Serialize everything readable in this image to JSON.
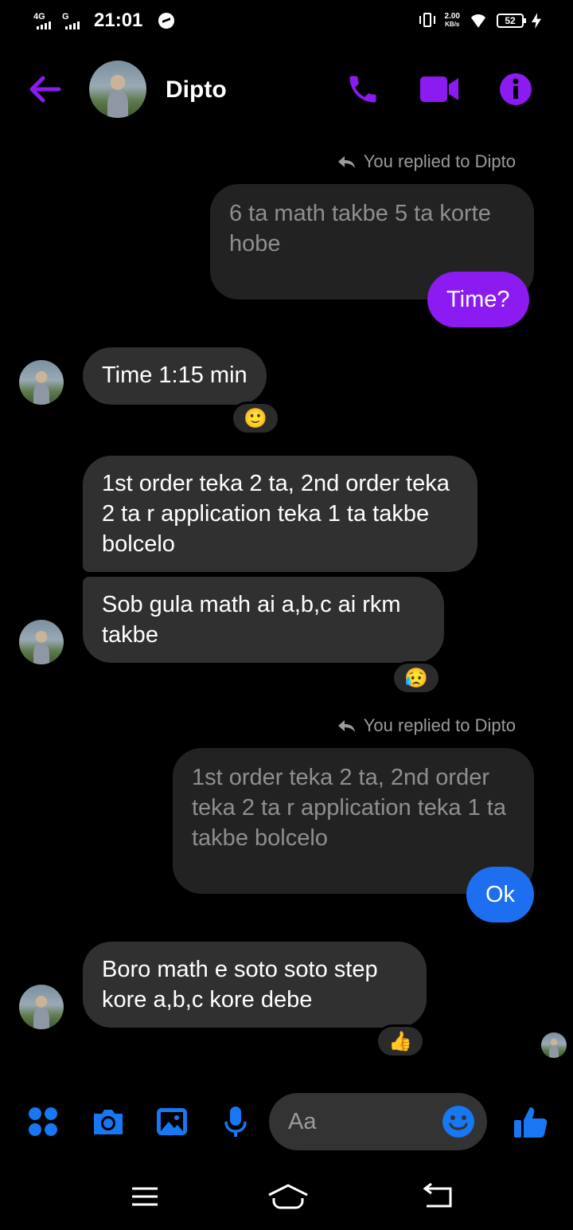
{
  "status": {
    "net1": "4G",
    "net2": "G",
    "time": "21:01",
    "speed_value": "2.00",
    "speed_unit": "KB/s",
    "battery": "52"
  },
  "header": {
    "contact_name": "Dipto"
  },
  "colors": {
    "accent_purple": "#8b1bf0",
    "outgoing_blue": "#1d6ff0",
    "composer_blue": "#1877f2",
    "incoming_bubble": "#303030"
  },
  "messages": {
    "reply1_meta": "You replied to Dipto",
    "reply1_quote": "6 ta math takbe 5 ta korte hobe",
    "reply1_text": "Time?",
    "in1_text": "Time 1:15 min",
    "in1_reaction": "🙂",
    "in2_text": "1st order teka 2 ta, 2nd order teka 2 ta r application teka 1 ta takbe bolcelo",
    "in3_text": "Sob gula math ai a,b,c ai rkm takbe",
    "in3_reaction": "😥",
    "reply2_meta": "You replied to Dipto",
    "reply2_quote": "1st order teka 2 ta, 2nd order teka 2 ta r application teka 1 ta takbe bolcelo",
    "reply2_text": "Ok",
    "in4_text": "Boro math e soto soto step kore a,b,c kore debe",
    "in4_reaction": "👍"
  },
  "composer": {
    "placeholder": "Aa"
  },
  "icons": [
    "back-arrow-icon",
    "phone-icon",
    "video-camera-icon",
    "info-icon",
    "menu-dots-icon",
    "camera-icon",
    "gallery-icon",
    "microphone-icon",
    "emoji-icon",
    "thumbs-up-icon"
  ]
}
